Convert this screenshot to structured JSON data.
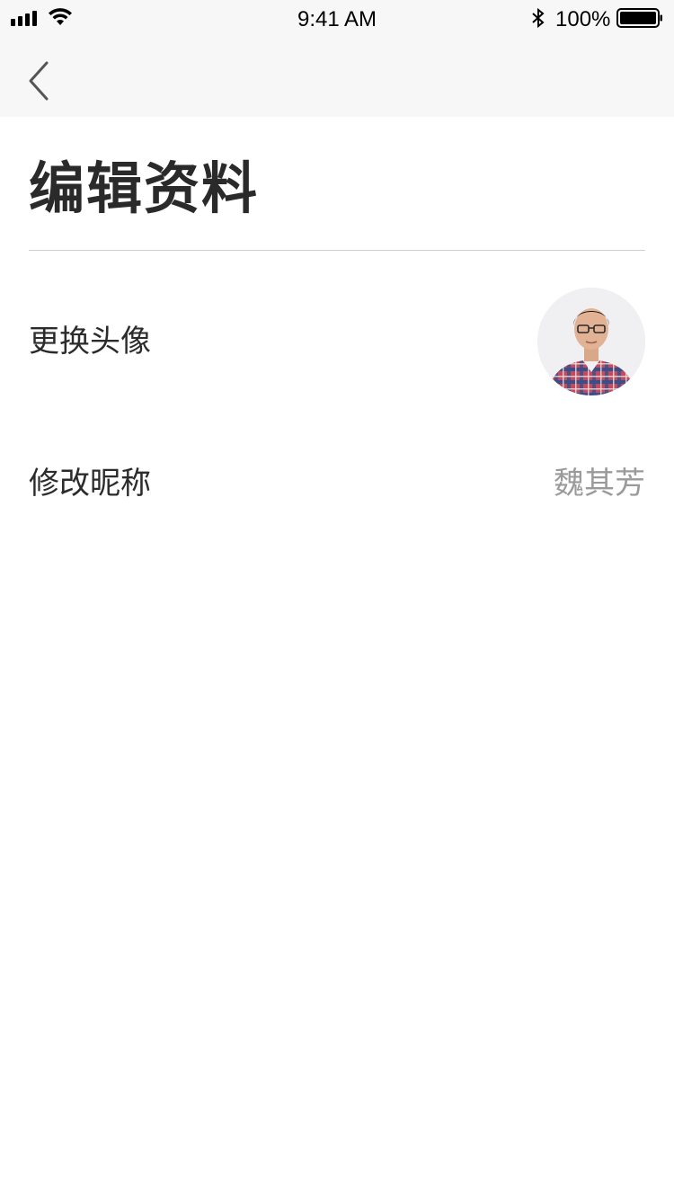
{
  "status_bar": {
    "time": "9:41 AM",
    "battery_percent": "100%",
    "icons": [
      "signal-icon",
      "wifi-icon",
      "bluetooth-icon",
      "battery-icon"
    ]
  },
  "nav": {
    "back_icon": "chevron-left-icon"
  },
  "page": {
    "title": "编辑资料"
  },
  "settings": {
    "avatar_row": {
      "label": "更换头像",
      "avatar": "avatar-photo"
    },
    "nickname_row": {
      "label": "修改昵称",
      "value": "魏其芳"
    }
  },
  "colors": {
    "top_bar_bg": "#f7f7f7",
    "title_text": "#2a2a2a",
    "value_text": "#9a9a9a",
    "divider": "#cfcfcf"
  }
}
